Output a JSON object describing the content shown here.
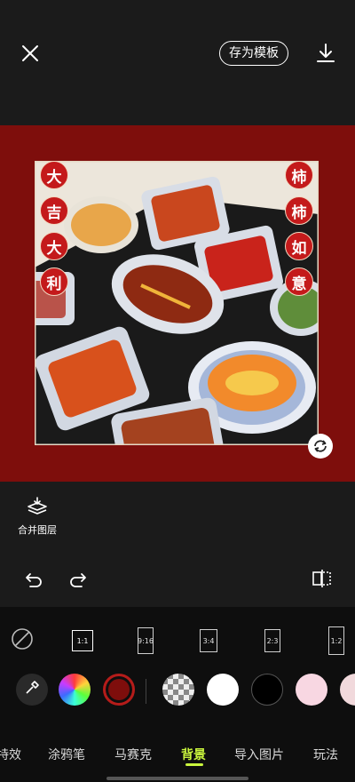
{
  "header": {
    "save_template_label": "存为模板"
  },
  "canvas": {
    "background_color": "#7e0e0c",
    "left_chars": [
      "大",
      "吉",
      "大",
      "利"
    ],
    "right_chars": [
      "柿",
      "柿",
      "如",
      "意"
    ]
  },
  "tools": {
    "merge_layers_label": "合并图层"
  },
  "ratios": {
    "items": [
      {
        "label": "",
        "icon": "none-icon"
      },
      {
        "label": "1:1",
        "selected": true
      },
      {
        "label": "9:16"
      },
      {
        "label": "3:4"
      },
      {
        "label": "2:3"
      },
      {
        "label": "1:2"
      }
    ]
  },
  "swatches": {
    "colors": [
      "#b51c1a",
      "#888888",
      "#ffffff",
      "#000000",
      "#f8d7e2",
      "#f1d9dc"
    ],
    "selected_color": "#7e0e0c"
  },
  "tabs": {
    "items": [
      "特效",
      "涂鸦笔",
      "马赛克",
      "背景",
      "导入图片",
      "玩法"
    ],
    "active": "背景",
    "accent_color": "#c9f53d"
  }
}
